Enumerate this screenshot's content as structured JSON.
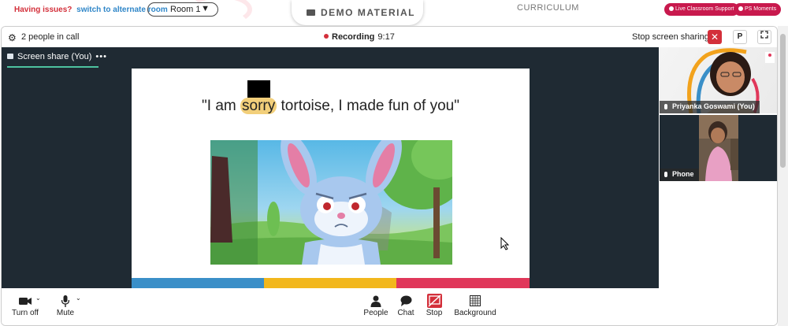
{
  "topbar": {
    "issues_text": "Having issues?",
    "alternate_link": "switch to alternate room",
    "room_value": "Room 1",
    "demo_material_label": "DEMO MATERIAL",
    "curriculum_label": "CURRICULUM",
    "live_support_label": "Live Classroom Support",
    "ps_moments_label": "PS Moments"
  },
  "call": {
    "people_count": "2 people in call",
    "recording_label": "Recording",
    "recording_time": "9:17",
    "stop_sharing_label": "Stop screen sharing",
    "p_button_label": "P",
    "share_tab_label": "Screen share (You)",
    "share_tab_menu": "•••"
  },
  "slide": {
    "caption_before": "\"I am ",
    "caption_highlight": "sorry",
    "caption_after": " tortoise, I made fun of you\""
  },
  "participants": [
    {
      "name": "Priyanka Goswami (You)"
    },
    {
      "name": "Phone"
    }
  ],
  "controls": {
    "camera_label": "Turn off",
    "mic_label": "Mute",
    "people_label": "People",
    "chat_label": "Chat",
    "stop_label": "Stop",
    "background_label": "Background"
  },
  "colors": {
    "accent_red": "#d32f3a",
    "pill_pink": "#c8194d",
    "stage_dark": "#1f2a33",
    "share_underline": "#4ec2a0",
    "bar_blue": "#3a8fc8",
    "bar_yellow": "#f2b71c",
    "bar_red": "#e0375a"
  }
}
